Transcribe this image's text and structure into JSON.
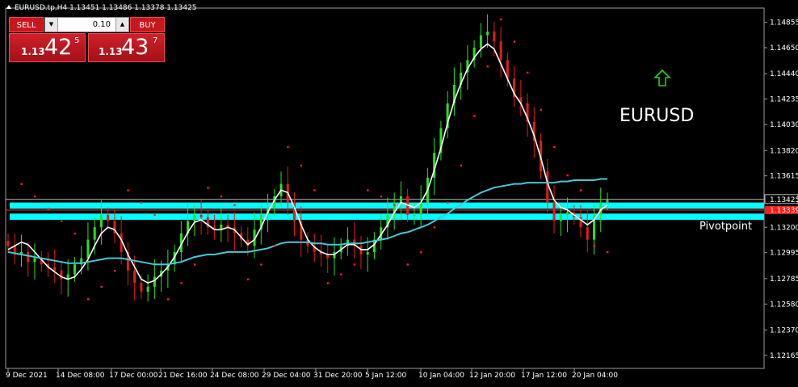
{
  "header": {
    "info": "EURUSD.tp,H4  1.13451 1.13486 1.13378 1.13425"
  },
  "trade_panel": {
    "sell_label": "SELL",
    "buy_label": "BUY",
    "lot": "0.10",
    "bid_prefix": "1.13",
    "bid_big": "42",
    "bid_sup": "5",
    "ask_prefix": "1.13",
    "ask_big": "43",
    "ask_sup": "7",
    "lot_down_icon": "triangle-down-icon",
    "lot_up_icon": "triangle-up-icon"
  },
  "annotations": {
    "symbol_label": "EURUSD",
    "pivot_label": "Pivotpoint",
    "arrow_icon": "up-arrow-icon"
  },
  "chart_data": {
    "type": "line",
    "symbol": "EURUSD.tp",
    "timeframe": "H4",
    "ohlc": {
      "open": 1.13451,
      "high": 1.13486,
      "low": 1.13378,
      "close": 1.13425
    },
    "ylim": [
      1.1206,
      1.1497
    ],
    "y_ticks": [
      "1.14855",
      "1.14650",
      "1.14440",
      "1.14235",
      "1.14030",
      "1.13820",
      "1.13615",
      "1.13425",
      "1.13200",
      "1.12995",
      "1.12785",
      "1.12580",
      "1.12370",
      "1.12165"
    ],
    "current_price_label": "1.13425",
    "red_line_label": "1.13339",
    "red_line_price": 1.13339,
    "pivot_zone": {
      "upper": 1.134,
      "lower": 1.1326
    },
    "x_ticks": [
      "9 Dec 2021",
      "14 Dec 08:00",
      "17 Dec 00:00",
      "21 Dec 16:00",
      "24 Dec 08:00",
      "29 Dec 04:00",
      "31 Dec 20:00",
      "5 Jan 12:00",
      "10 Jan 04:00",
      "12 Jan 20:00",
      "17 Jan 12:00",
      "20 Jan 04:00"
    ],
    "close_series": [
      1.1305,
      1.1298,
      1.13,
      1.1292,
      1.1295,
      1.129,
      1.1288,
      1.1285,
      1.1278,
      1.1282,
      1.129,
      1.1295,
      1.131,
      1.132,
      1.133,
      1.1325,
      1.1315,
      1.13,
      1.1285,
      1.1275,
      1.1268,
      1.1272,
      1.128,
      1.1285,
      1.129,
      1.13,
      1.1315,
      1.1325,
      1.133,
      1.1328,
      1.132,
      1.1318,
      1.1322,
      1.132,
      1.1315,
      1.131,
      1.1305,
      1.1318,
      1.133,
      1.1335,
      1.1345,
      1.1355,
      1.134,
      1.1325,
      1.131,
      1.1305,
      1.13,
      1.1298,
      1.1295,
      1.13,
      1.1305,
      1.131,
      1.1305,
      1.1298,
      1.13,
      1.131,
      1.132,
      1.133,
      1.134,
      1.1345,
      1.133,
      1.133,
      1.134,
      1.136,
      1.138,
      1.14,
      1.142,
      1.1435,
      1.1445,
      1.1455,
      1.1465,
      1.1475,
      1.1478,
      1.147,
      1.1455,
      1.144,
      1.1425,
      1.142,
      1.1405,
      1.139,
      1.1365,
      1.134,
      1.1325,
      1.133,
      1.1332,
      1.1328,
      1.132,
      1.131,
      1.133,
      1.134,
      1.1342
    ],
    "overlays": [
      {
        "name": "",
        "type": "line",
        "color": "#ffffff",
        "values": [
          1.1302,
          1.1305,
          1.1308,
          1.1306,
          1.13,
          1.1294,
          1.1288,
          1.1284,
          1.128,
          1.1278,
          1.128,
          1.1286,
          1.1294,
          1.1305,
          1.1315,
          1.132,
          1.1318,
          1.131,
          1.1298,
          1.1288,
          1.1278,
          1.1275,
          1.1277,
          1.1282,
          1.1288,
          1.1296,
          1.1306,
          1.1316,
          1.1324,
          1.1326,
          1.1322,
          1.1318,
          1.1318,
          1.132,
          1.1318,
          1.1312,
          1.1306,
          1.131,
          1.132,
          1.1332,
          1.1342,
          1.135,
          1.1348,
          1.1336,
          1.1322,
          1.131,
          1.1304,
          1.13,
          1.1298,
          1.1298,
          1.1302,
          1.1306,
          1.1306,
          1.1302,
          1.1302,
          1.1306,
          1.1314,
          1.1322,
          1.1332,
          1.134,
          1.1338,
          1.1336,
          1.134,
          1.135,
          1.1366,
          1.1384,
          1.1404,
          1.1422,
          1.1436,
          1.1448,
          1.1457,
          1.1464,
          1.1468,
          1.1464,
          1.1452,
          1.144,
          1.1428,
          1.142,
          1.1408,
          1.1394,
          1.1376,
          1.1356,
          1.1342,
          1.1336,
          1.1334,
          1.133,
          1.1326,
          1.1322,
          1.1326,
          1.1334,
          1.1338
        ]
      },
      {
        "name": "",
        "type": "line",
        "color": "#45c8d8",
        "values": [
          1.13,
          1.1299,
          1.1298,
          1.1297,
          1.1296,
          1.1295,
          1.1294,
          1.1293,
          1.1292,
          1.1291,
          1.1291,
          1.1291,
          1.1292,
          1.1293,
          1.1294,
          1.1295,
          1.1295,
          1.1295,
          1.1294,
          1.1293,
          1.1292,
          1.1291,
          1.129,
          1.129,
          1.129,
          1.1291,
          1.1292,
          1.1294,
          1.1296,
          1.1297,
          1.1298,
          1.1298,
          1.1299,
          1.13,
          1.13,
          1.13,
          1.13,
          1.1301,
          1.1302,
          1.1303,
          1.1305,
          1.1307,
          1.1308,
          1.1308,
          1.1308,
          1.1308,
          1.1307,
          1.1307,
          1.1306,
          1.1306,
          1.1306,
          1.1307,
          1.1307,
          1.1307,
          1.1308,
          1.1309,
          1.131,
          1.1311,
          1.1313,
          1.1315,
          1.1316,
          1.1318,
          1.132,
          1.1322,
          1.1325,
          1.1328,
          1.1331,
          1.1335,
          1.1338,
          1.1342,
          1.1345,
          1.1348,
          1.135,
          1.1352,
          1.1353,
          1.1354,
          1.1355,
          1.1355,
          1.1356,
          1.1356,
          1.1356,
          1.1356,
          1.1356,
          1.1357,
          1.1357,
          1.1358,
          1.1358,
          1.1358,
          1.1358,
          1.1359,
          1.1359
        ]
      }
    ],
    "parabolic_sar": [
      {
        "x": 2,
        "y": 1.1355
      },
      {
        "x": 4,
        "y": 1.1345
      },
      {
        "x": 6,
        "y": 1.1335
      },
      {
        "x": 8,
        "y": 1.1325
      },
      {
        "x": 10,
        "y": 1.1315
      },
      {
        "x": 12,
        "y": 1.1262
      },
      {
        "x": 14,
        "y": 1.1272
      },
      {
        "x": 16,
        "y": 1.1285
      },
      {
        "x": 18,
        "y": 1.135
      },
      {
        "x": 20,
        "y": 1.134
      },
      {
        "x": 22,
        "y": 1.133
      },
      {
        "x": 24,
        "y": 1.1262
      },
      {
        "x": 26,
        "y": 1.1275
      },
      {
        "x": 28,
        "y": 1.129
      },
      {
        "x": 30,
        "y": 1.1352
      },
      {
        "x": 32,
        "y": 1.1345
      },
      {
        "x": 34,
        "y": 1.1338
      },
      {
        "x": 36,
        "y": 1.1278
      },
      {
        "x": 38,
        "y": 1.129
      },
      {
        "x": 40,
        "y": 1.1305
      },
      {
        "x": 42,
        "y": 1.1385
      },
      {
        "x": 44,
        "y": 1.137
      },
      {
        "x": 46,
        "y": 1.135
      },
      {
        "x": 48,
        "y": 1.1275
      },
      {
        "x": 50,
        "y": 1.1282
      },
      {
        "x": 52,
        "y": 1.129
      },
      {
        "x": 54,
        "y": 1.135
      },
      {
        "x": 56,
        "y": 1.1345
      },
      {
        "x": 58,
        "y": 1.1338
      },
      {
        "x": 60,
        "y": 1.129
      },
      {
        "x": 62,
        "y": 1.13
      },
      {
        "x": 64,
        "y": 1.132
      },
      {
        "x": 66,
        "y": 1.134
      },
      {
        "x": 68,
        "y": 1.137
      },
      {
        "x": 70,
        "y": 1.141
      },
      {
        "x": 72,
        "y": 1.145
      },
      {
        "x": 74,
        "y": 1.1488
      },
      {
        "x": 76,
        "y": 1.147
      },
      {
        "x": 78,
        "y": 1.1445
      },
      {
        "x": 80,
        "y": 1.1415
      },
      {
        "x": 82,
        "y": 1.1385
      },
      {
        "x": 84,
        "y": 1.1362
      },
      {
        "x": 86,
        "y": 1.135
      },
      {
        "x": 88,
        "y": 1.1305
      },
      {
        "x": 90,
        "y": 1.13
      }
    ],
    "grid": false,
    "legend": "none"
  }
}
